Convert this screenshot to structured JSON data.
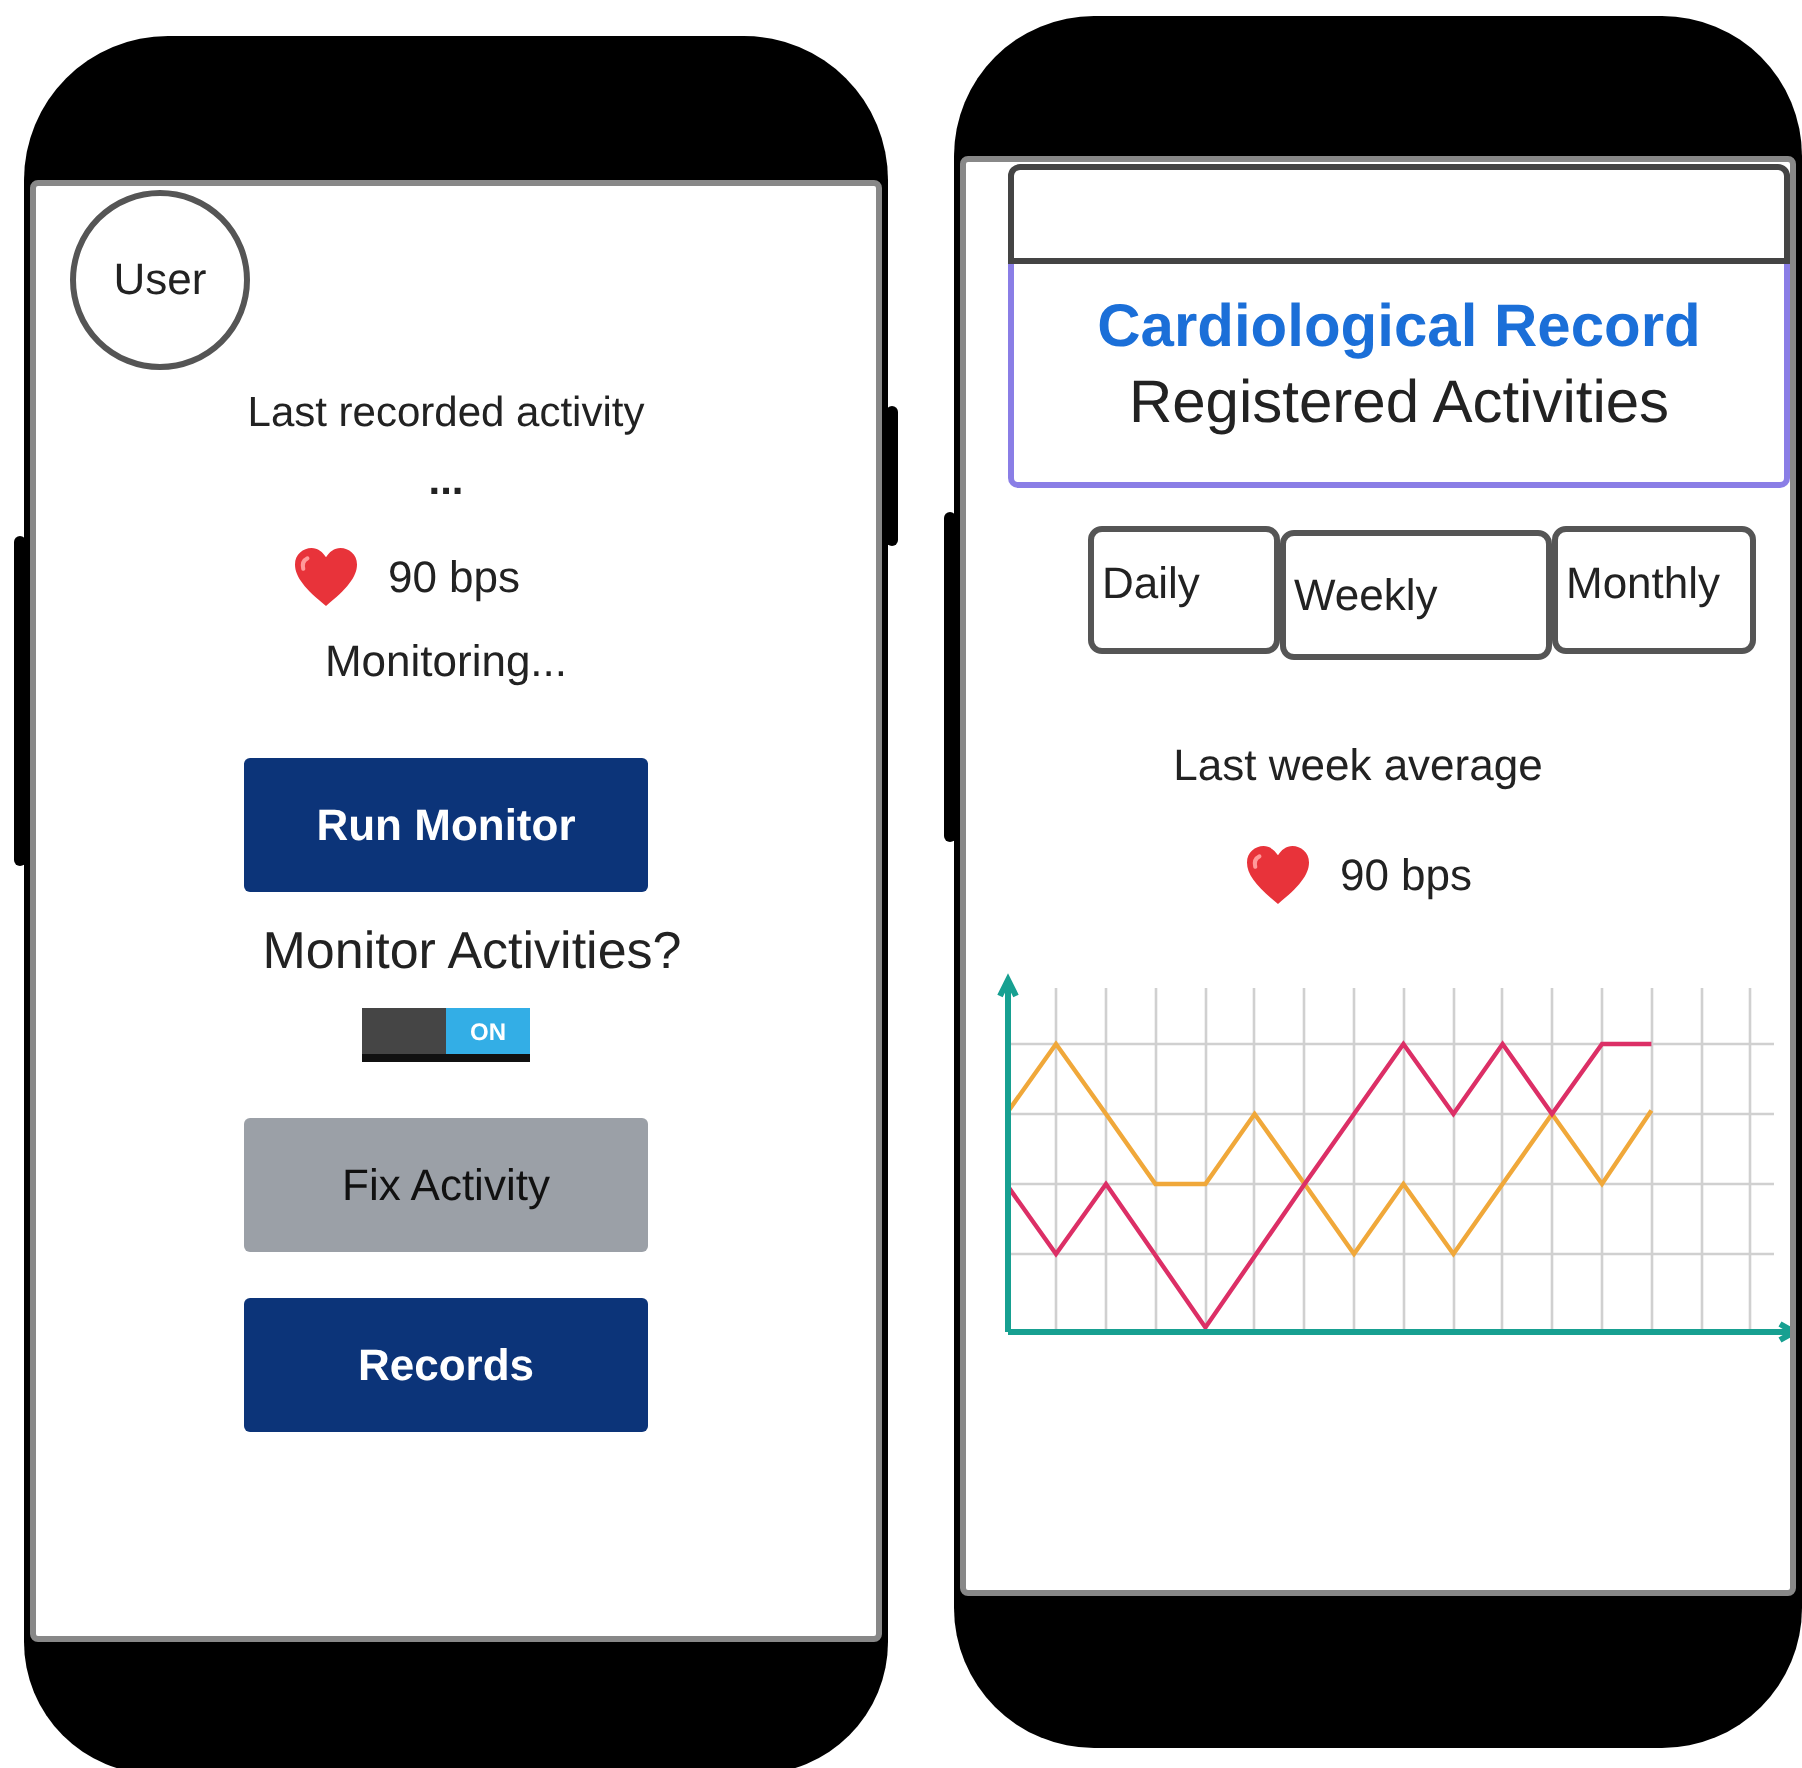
{
  "monitor_screen": {
    "avatar_label": "User",
    "last_activity": {
      "label": "Last recorded activity",
      "value": "..."
    },
    "heart_rate": "90 bps",
    "status": "Monitoring...",
    "run_button": {
      "label": "Run Monitor",
      "kind": "primary"
    },
    "toggle": {
      "label": "Monitor Activities?",
      "on": true,
      "state_text": "ON"
    },
    "buttons": [
      {
        "label": "Fix Activity",
        "kind": "secondary"
      },
      {
        "label": "Records",
        "kind": "primary"
      }
    ]
  },
  "record_screen": {
    "title": "Cardiological Record",
    "subtitle": "Registered Activities",
    "tabs": [
      {
        "label": "Daily",
        "selected": false
      },
      {
        "label": "Weekly",
        "selected": true
      },
      {
        "label": "Monthly",
        "selected": false
      }
    ],
    "average_label": "Last week average",
    "heart_rate": "90 bps"
  }
}
